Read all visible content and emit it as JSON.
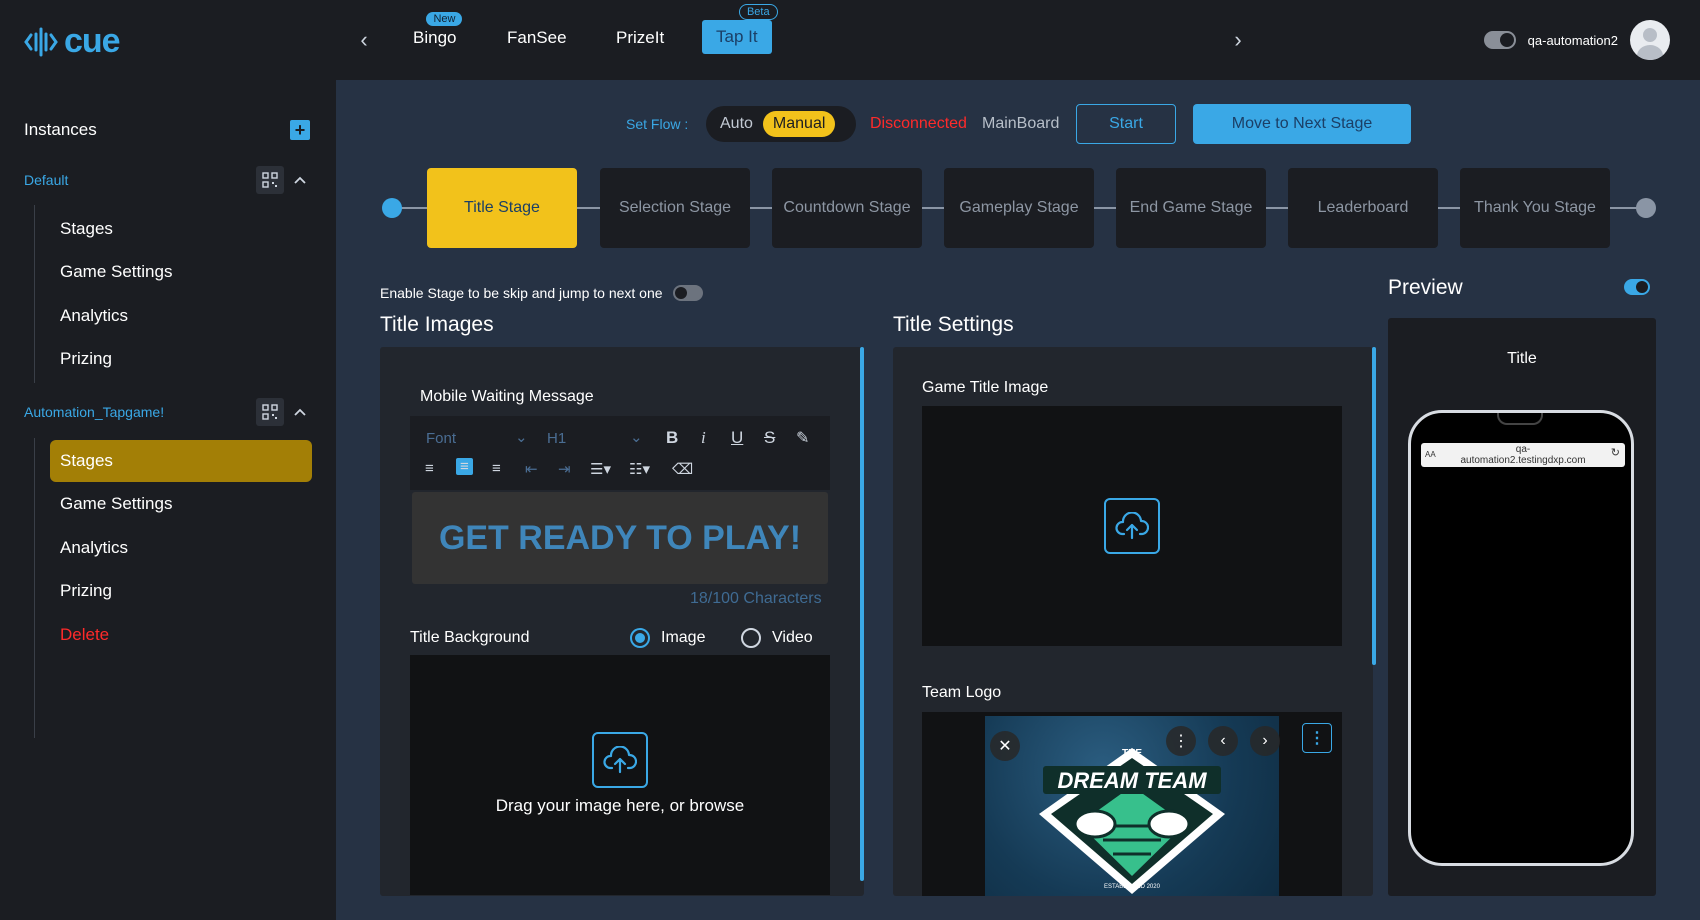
{
  "app": {
    "logo_text": "cue",
    "brand_color": "#3aa8e6",
    "accent_color": "#f2c21b",
    "danger_color": "#ff2a2a"
  },
  "topnav": {
    "tabs": [
      {
        "label": "Bingo",
        "badge": "New"
      },
      {
        "label": "FanSee",
        "badge": ""
      },
      {
        "label": "PrizeIt",
        "badge": ""
      },
      {
        "label": "Tap It",
        "badge": "Beta",
        "active": true
      }
    ],
    "prev_icon": "chevron-left-icon",
    "next_icon": "chevron-right-icon",
    "username": "qa-automation2"
  },
  "sidebar": {
    "header": "Instances",
    "groups": [
      {
        "title": "Default",
        "items": [
          "Stages",
          "Game Settings",
          "Analytics",
          "Prizing"
        ]
      },
      {
        "title": "Automation_Tapgame!",
        "items": [
          "Stages",
          "Game Settings",
          "Analytics",
          "Prizing",
          "Delete"
        ],
        "active_item": "Stages"
      }
    ]
  },
  "flow": {
    "label": "Set Flow :",
    "options": [
      "Auto",
      "Manual"
    ],
    "selected": "Manual",
    "connection_status": "Disconnected",
    "board_name": "MainBoard",
    "start_label": "Start",
    "next_stage_label": "Move to Next Stage"
  },
  "stages": [
    "Title Stage",
    "Selection Stage",
    "Countdown Stage",
    "Gameplay Stage",
    "End Game Stage",
    "Leaderboard",
    "Thank You Stage"
  ],
  "active_stage": "Title Stage",
  "skip_toggle_label": "Enable Stage to be skip and jump to next one",
  "title_images": {
    "heading": "Title Images",
    "mobile_waiting_label": "Mobile Waiting Message",
    "editor": {
      "font_placeholder": "Font",
      "heading_select": "H1",
      "content": "GET READY TO PLAY!",
      "char_count": "18/100 Characters"
    },
    "background_label": "Title Background",
    "bg_options": [
      "Image",
      "Video"
    ],
    "bg_selected": "Image",
    "drop_text": "Drag your image here, or browse"
  },
  "title_settings": {
    "heading": "Title Settings",
    "game_title_image_label": "Game Title Image",
    "team_logo_label": "Team Logo",
    "team_logo_text_top": "THE",
    "team_logo_text": "DREAM TEAM",
    "team_logo_text_bottom": "ESTABLISHED 2020"
  },
  "preview": {
    "heading": "Preview",
    "screen_title": "Title",
    "url_line1": "qa-",
    "url_line2": "automation2.testingdxp.com",
    "aa": "AA"
  }
}
